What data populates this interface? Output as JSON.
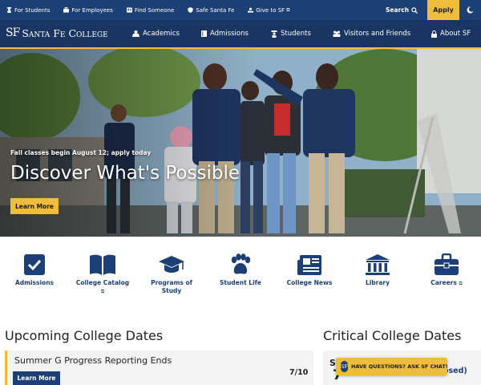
{
  "utility": {
    "links": [
      {
        "label": "For Students",
        "icon": "student-icon"
      },
      {
        "label": "For Employees",
        "icon": "briefcase-icon"
      },
      {
        "label": "Find Someone",
        "icon": "id-card-icon"
      },
      {
        "label": "Safe Santa Fe",
        "icon": "shield-icon"
      },
      {
        "label": "Give to SF",
        "icon": "donate-icon"
      }
    ],
    "search_label": "Search",
    "apply_label": "Apply",
    "mode_icon": "contrast-icon"
  },
  "nav": {
    "logo_mark": "SF",
    "logo_text": "Santa Fe College",
    "items": [
      {
        "label": "Academics",
        "icon": "academics-icon"
      },
      {
        "label": "Admissions",
        "icon": "book-icon"
      },
      {
        "label": "Students",
        "icon": "student-icon"
      },
      {
        "label": "Visitors and Friends",
        "icon": "people-icon"
      },
      {
        "label": "About SF",
        "icon": "lock-icon"
      }
    ]
  },
  "hero": {
    "kicker": "Fall classes begin August 12; apply today",
    "title": "Discover What's Possible",
    "button": "Learn More"
  },
  "quick_links": [
    {
      "label": "Admissions",
      "icon": "checkbox-icon",
      "external": false
    },
    {
      "label": "College Catalog",
      "icon": "open-book-icon",
      "external": true
    },
    {
      "label": "Programs of Study",
      "icon": "graduation-cap-icon",
      "external": false
    },
    {
      "label": "Student Life",
      "icon": "paw-icon",
      "external": false
    },
    {
      "label": "College News",
      "icon": "newspaper-icon",
      "external": false
    },
    {
      "label": "Library",
      "icon": "library-icon",
      "external": false
    },
    {
      "label": "Careers",
      "icon": "toolbox-icon",
      "external": true
    }
  ],
  "upcoming": {
    "heading": "Upcoming College Dates",
    "event_title": "Summer G Progress Reporting Ends",
    "event_button": "Learn More",
    "event_date": "7/10"
  },
  "critical": {
    "heading": "Critical College Dates",
    "partial_title": "S",
    "partial_day": "7",
    "partial_status": "osed)"
  },
  "chat": {
    "label": "HAVE QUESTIONS? ASK SF CHAT!",
    "logo_mark": "SF"
  },
  "colors": {
    "navy": "#1c3f75",
    "nav_dark": "#1a3561",
    "gold": "#f0bc3c"
  }
}
